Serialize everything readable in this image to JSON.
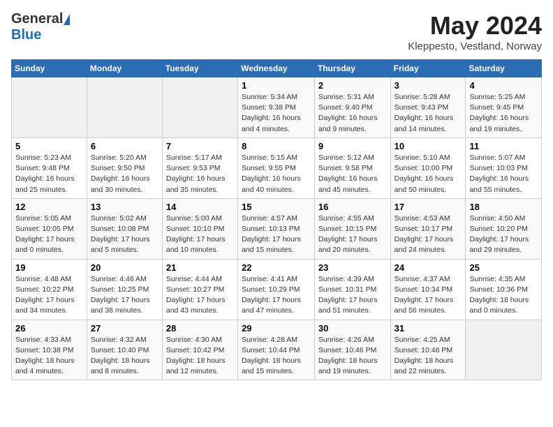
{
  "header": {
    "logo_general": "General",
    "logo_blue": "Blue",
    "month_title": "May 2024",
    "location": "Kleppesto, Vestland, Norway"
  },
  "calendar": {
    "days_of_week": [
      "Sunday",
      "Monday",
      "Tuesday",
      "Wednesday",
      "Thursday",
      "Friday",
      "Saturday"
    ],
    "weeks": [
      [
        {
          "day": "",
          "info": ""
        },
        {
          "day": "",
          "info": ""
        },
        {
          "day": "",
          "info": ""
        },
        {
          "day": "1",
          "info": "Sunrise: 5:34 AM\nSunset: 9:38 PM\nDaylight: 16 hours\nand 4 minutes."
        },
        {
          "day": "2",
          "info": "Sunrise: 5:31 AM\nSunset: 9:40 PM\nDaylight: 16 hours\nand 9 minutes."
        },
        {
          "day": "3",
          "info": "Sunrise: 5:28 AM\nSunset: 9:43 PM\nDaylight: 16 hours\nand 14 minutes."
        },
        {
          "day": "4",
          "info": "Sunrise: 5:25 AM\nSunset: 9:45 PM\nDaylight: 16 hours\nand 19 minutes."
        }
      ],
      [
        {
          "day": "5",
          "info": "Sunrise: 5:23 AM\nSunset: 9:48 PM\nDaylight: 16 hours\nand 25 minutes."
        },
        {
          "day": "6",
          "info": "Sunrise: 5:20 AM\nSunset: 9:50 PM\nDaylight: 16 hours\nand 30 minutes."
        },
        {
          "day": "7",
          "info": "Sunrise: 5:17 AM\nSunset: 9:53 PM\nDaylight: 16 hours\nand 35 minutes."
        },
        {
          "day": "8",
          "info": "Sunrise: 5:15 AM\nSunset: 9:55 PM\nDaylight: 16 hours\nand 40 minutes."
        },
        {
          "day": "9",
          "info": "Sunrise: 5:12 AM\nSunset: 9:58 PM\nDaylight: 16 hours\nand 45 minutes."
        },
        {
          "day": "10",
          "info": "Sunrise: 5:10 AM\nSunset: 10:00 PM\nDaylight: 16 hours\nand 50 minutes."
        },
        {
          "day": "11",
          "info": "Sunrise: 5:07 AM\nSunset: 10:03 PM\nDaylight: 16 hours\nand 55 minutes."
        }
      ],
      [
        {
          "day": "12",
          "info": "Sunrise: 5:05 AM\nSunset: 10:05 PM\nDaylight: 17 hours\nand 0 minutes."
        },
        {
          "day": "13",
          "info": "Sunrise: 5:02 AM\nSunset: 10:08 PM\nDaylight: 17 hours\nand 5 minutes."
        },
        {
          "day": "14",
          "info": "Sunrise: 5:00 AM\nSunset: 10:10 PM\nDaylight: 17 hours\nand 10 minutes."
        },
        {
          "day": "15",
          "info": "Sunrise: 4:57 AM\nSunset: 10:13 PM\nDaylight: 17 hours\nand 15 minutes."
        },
        {
          "day": "16",
          "info": "Sunrise: 4:55 AM\nSunset: 10:15 PM\nDaylight: 17 hours\nand 20 minutes."
        },
        {
          "day": "17",
          "info": "Sunrise: 4:53 AM\nSunset: 10:17 PM\nDaylight: 17 hours\nand 24 minutes."
        },
        {
          "day": "18",
          "info": "Sunrise: 4:50 AM\nSunset: 10:20 PM\nDaylight: 17 hours\nand 29 minutes."
        }
      ],
      [
        {
          "day": "19",
          "info": "Sunrise: 4:48 AM\nSunset: 10:22 PM\nDaylight: 17 hours\nand 34 minutes."
        },
        {
          "day": "20",
          "info": "Sunrise: 4:46 AM\nSunset: 10:25 PM\nDaylight: 17 hours\nand 38 minutes."
        },
        {
          "day": "21",
          "info": "Sunrise: 4:44 AM\nSunset: 10:27 PM\nDaylight: 17 hours\nand 43 minutes."
        },
        {
          "day": "22",
          "info": "Sunrise: 4:41 AM\nSunset: 10:29 PM\nDaylight: 17 hours\nand 47 minutes."
        },
        {
          "day": "23",
          "info": "Sunrise: 4:39 AM\nSunset: 10:31 PM\nDaylight: 17 hours\nand 51 minutes."
        },
        {
          "day": "24",
          "info": "Sunrise: 4:37 AM\nSunset: 10:34 PM\nDaylight: 17 hours\nand 56 minutes."
        },
        {
          "day": "25",
          "info": "Sunrise: 4:35 AM\nSunset: 10:36 PM\nDaylight: 18 hours\nand 0 minutes."
        }
      ],
      [
        {
          "day": "26",
          "info": "Sunrise: 4:33 AM\nSunset: 10:38 PM\nDaylight: 18 hours\nand 4 minutes."
        },
        {
          "day": "27",
          "info": "Sunrise: 4:32 AM\nSunset: 10:40 PM\nDaylight: 18 hours\nand 8 minutes."
        },
        {
          "day": "28",
          "info": "Sunrise: 4:30 AM\nSunset: 10:42 PM\nDaylight: 18 hours\nand 12 minutes."
        },
        {
          "day": "29",
          "info": "Sunrise: 4:28 AM\nSunset: 10:44 PM\nDaylight: 18 hours\nand 15 minutes."
        },
        {
          "day": "30",
          "info": "Sunrise: 4:26 AM\nSunset: 10:46 PM\nDaylight: 18 hours\nand 19 minutes."
        },
        {
          "day": "31",
          "info": "Sunrise: 4:25 AM\nSunset: 10:48 PM\nDaylight: 18 hours\nand 22 minutes."
        },
        {
          "day": "",
          "info": ""
        }
      ]
    ]
  }
}
